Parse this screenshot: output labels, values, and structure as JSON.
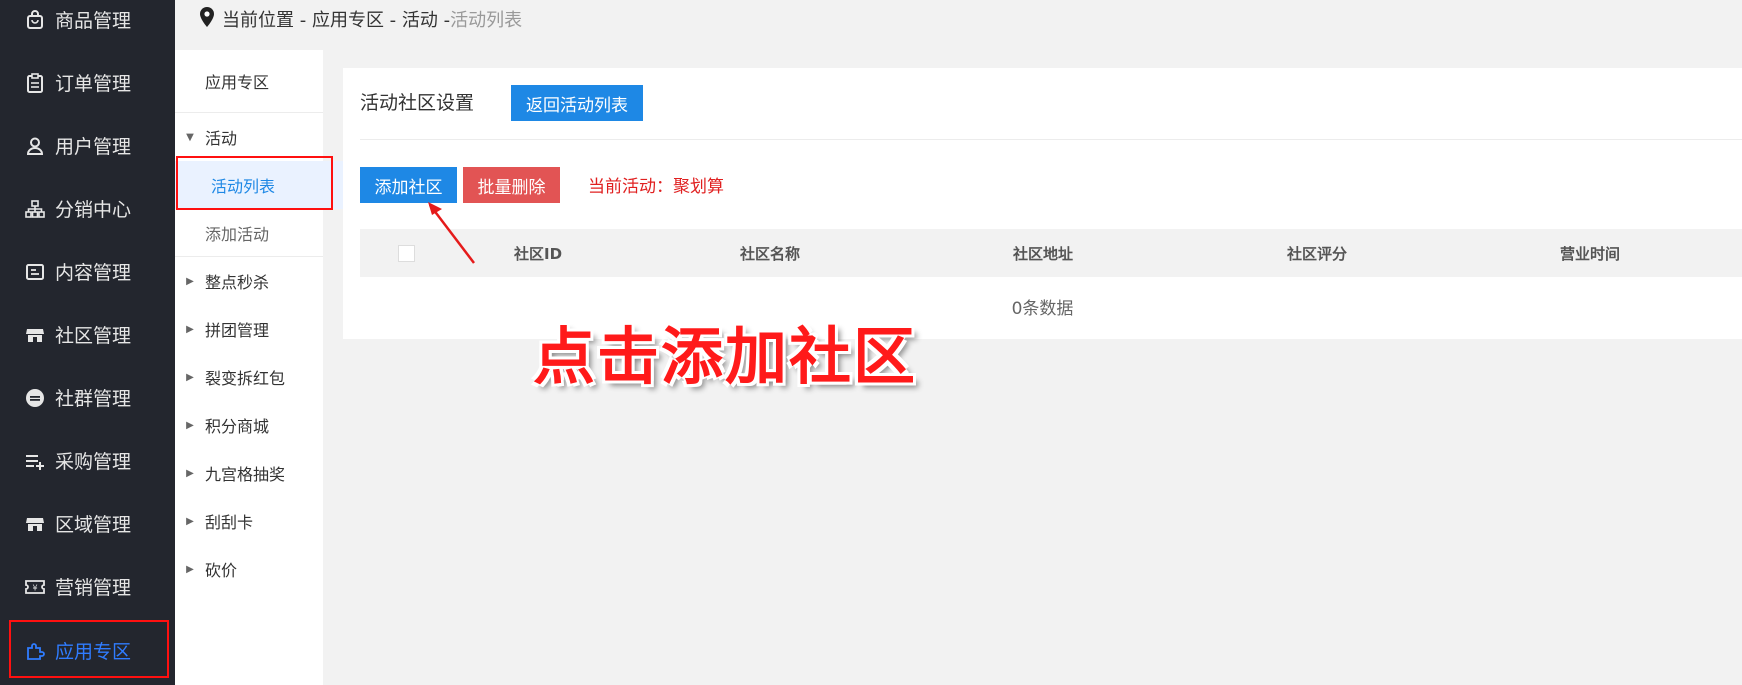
{
  "sidebar": {
    "items": [
      {
        "label": "商品管理",
        "icon": "shopping-bag-icon"
      },
      {
        "label": "订单管理",
        "icon": "clipboard-icon"
      },
      {
        "label": "用户管理",
        "icon": "user-icon"
      },
      {
        "label": "分销中心",
        "icon": "sitemap-icon"
      },
      {
        "label": "内容管理",
        "icon": "content-icon"
      },
      {
        "label": "社区管理",
        "icon": "store-icon"
      },
      {
        "label": "社群管理",
        "icon": "minus-circle-icon"
      },
      {
        "label": "采购管理",
        "icon": "playlist-add-icon"
      },
      {
        "label": "区域管理",
        "icon": "store-icon"
      },
      {
        "label": "营销管理",
        "icon": "ticket-icon"
      },
      {
        "label": "应用专区",
        "icon": "puzzle-icon"
      }
    ],
    "active": "应用专区"
  },
  "breadcrumb": {
    "prefix": "当前位置 - 应用专区 - 活动 - ",
    "current": "活动列表"
  },
  "subnav": {
    "header": "应用专区",
    "groups": [
      {
        "label": "活动",
        "expanded": true
      },
      {
        "label": "整点秒杀"
      },
      {
        "label": "拼团管理"
      },
      {
        "label": "裂变拆红包"
      },
      {
        "label": "积分商城"
      },
      {
        "label": "九宫格抽奖"
      },
      {
        "label": "刮刮卡"
      },
      {
        "label": "砍价"
      }
    ],
    "children": [
      {
        "label": "活动列表",
        "selected": true
      },
      {
        "label": "添加活动"
      }
    ]
  },
  "main": {
    "title": "活动社区设置",
    "back_button": "返回活动列表",
    "add_button": "添加社区",
    "batch_delete_button": "批量删除",
    "current_activity": "当前活动：聚划算",
    "columns": [
      "社区ID",
      "社区名称",
      "社区地址",
      "社区评分",
      "营业时间"
    ],
    "empty_text": "0条数据"
  },
  "annotation": {
    "label": "点击添加社区",
    "color": "#ff1a1a"
  },
  "colors": {
    "primary": "#1e88e5",
    "danger": "#e25454",
    "sidebar_bg": "#23262e",
    "active": "#2f7cff"
  }
}
